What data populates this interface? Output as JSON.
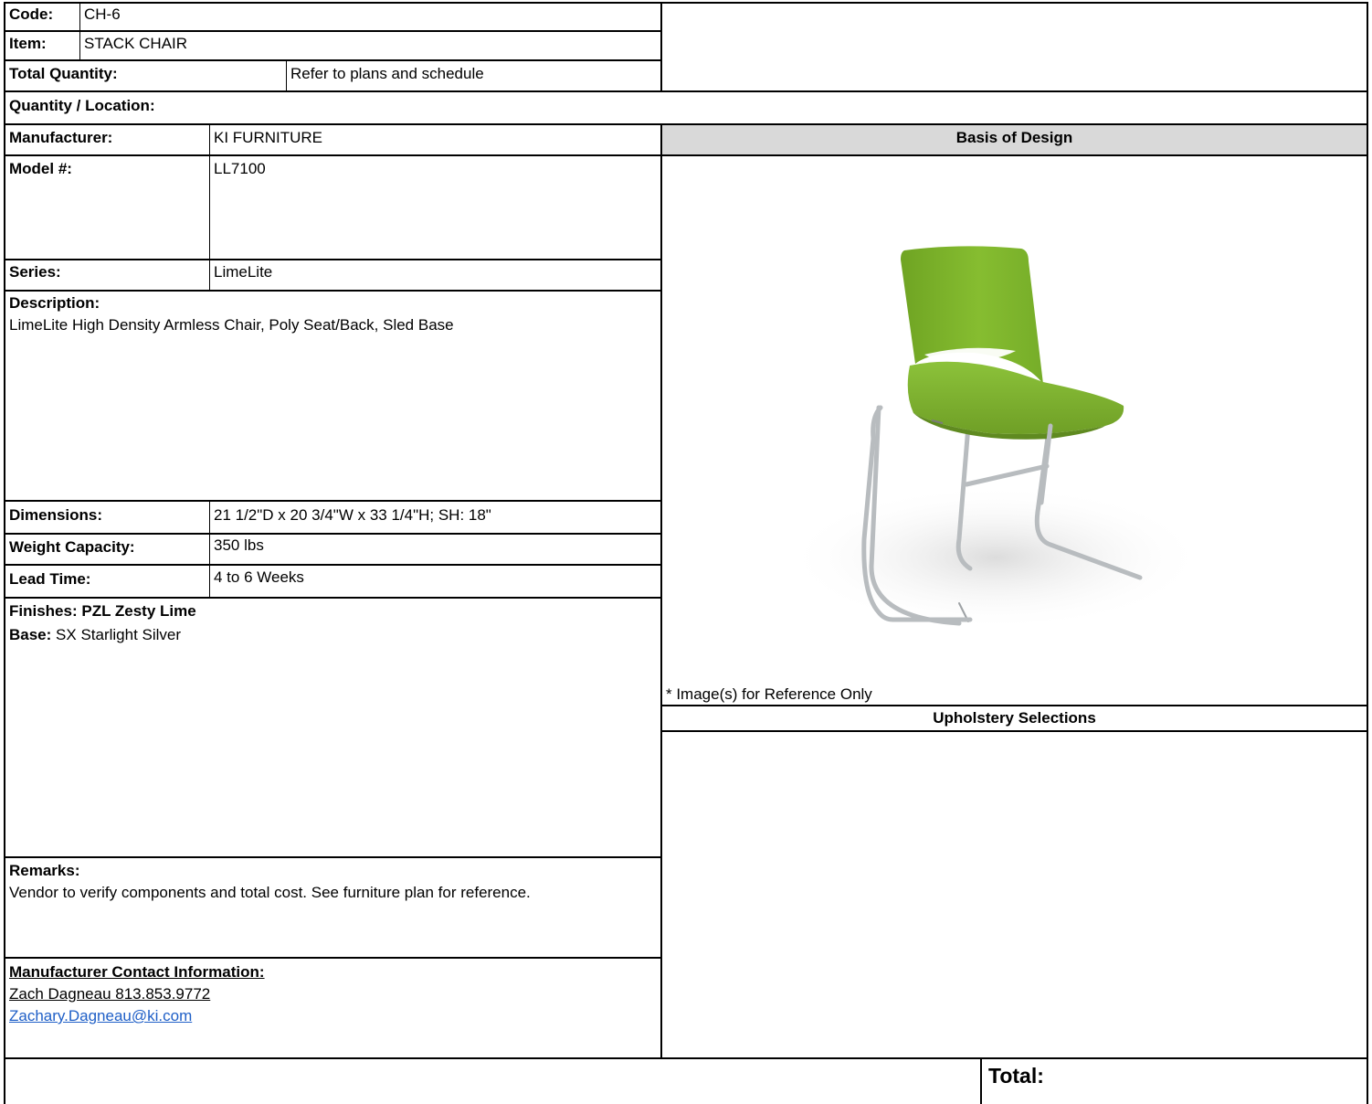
{
  "code": {
    "label": "Code:",
    "value": "CH-6"
  },
  "item": {
    "label": "Item:",
    "value": "STACK CHAIR"
  },
  "total_quantity": {
    "label": "Total Quantity:",
    "value": "Refer to plans and schedule"
  },
  "quantity_location": {
    "label": "Quantity / Location:"
  },
  "manufacturer": {
    "label": "Manufacturer:",
    "value": "KI FURNITURE"
  },
  "basis_of_design": {
    "label": "Basis of Design"
  },
  "model": {
    "label": "Model #:",
    "value": "LL7100"
  },
  "series": {
    "label": "Series:",
    "value": "LimeLite"
  },
  "description": {
    "label": "Description:",
    "value": "LimeLite High Density Armless Chair, Poly Seat/Back, Sled Base"
  },
  "dimensions": {
    "label": "Dimensions:",
    "value": "21 1/2\"D x 20 3/4\"W x 33 1/4\"H; SH: 18\""
  },
  "weight_capacity": {
    "label": "Weight Capacity:",
    "value": "350 lbs"
  },
  "lead_time": {
    "label": "Lead Time:",
    "value": "4 to 6 Weeks"
  },
  "finishes": {
    "label": "Finishes:",
    "value": "PZL Zesty Lime"
  },
  "base": {
    "label": "Base:",
    "value": "SX Starlight Silver"
  },
  "image_note": "* Image(s) for Reference Only",
  "upholstery": {
    "label": "Upholstery Selections"
  },
  "remarks": {
    "label": "Remarks:",
    "value": "Vendor to verify components and total cost. See furniture plan for reference."
  },
  "contact": {
    "label": "Manufacturer Contact Information:",
    "name_phone": "Zach Dagneau 813.853.9772",
    "email": "Zachary.Dagneau@ki.com"
  },
  "total": {
    "label": "Total:"
  },
  "colors": {
    "shade": "#d9d9d9",
    "link": "#1f5fc7",
    "chair_seat": "#7fb62c",
    "chair_frame": "#b8bcbf"
  }
}
